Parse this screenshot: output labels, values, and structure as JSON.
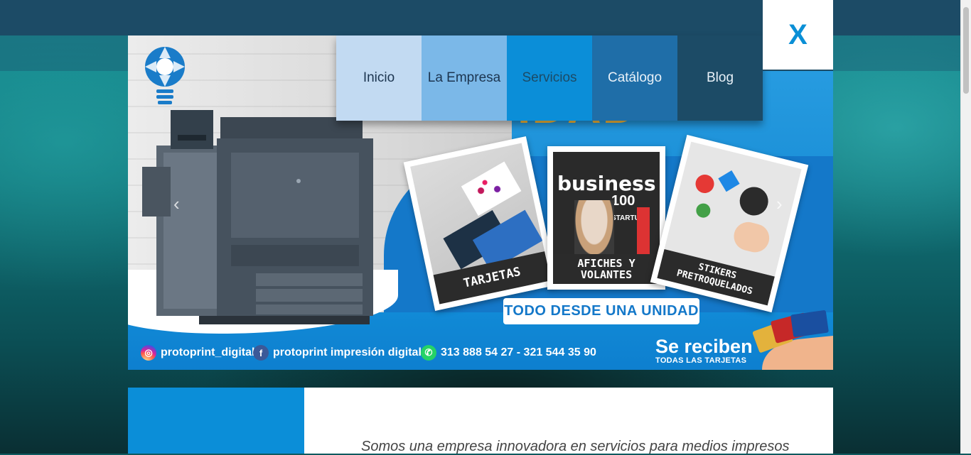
{
  "close_button": {
    "label": "X"
  },
  "nav": {
    "items": [
      {
        "label": "Inicio",
        "bg": "#c2daf2",
        "color": "#1c3550"
      },
      {
        "label": "La Empresa",
        "bg": "#7bb8e8",
        "color": "#1c3550"
      },
      {
        "label": "Servicios",
        "bg": "#0b8ed8",
        "color": "#1c4b66"
      },
      {
        "label": "Catálogo",
        "bg": "#1f6ea8",
        "color": "#e8f1f8"
      },
      {
        "label": "Blog",
        "bg": "#1c4b66",
        "color": "#e8f1f8"
      }
    ]
  },
  "banner": {
    "headline": "IDAD",
    "cards": [
      {
        "caption": "TARJETAS"
      },
      {
        "caption": "AFICHES Y VOLANTES",
        "magazine_title": "business",
        "magazine_number": "100",
        "magazine_sub": "STARTUP"
      },
      {
        "caption": "STIKERS PRETROQUELADOS"
      }
    ],
    "unidad": "TODO DESDE UNA UNIDAD",
    "instagram": "protoprint_digital",
    "facebook": "protoprint impresión digital",
    "whatsapp": "313 888 54 27 - 321 544 35 90",
    "reciben_big": "Se reciben",
    "reciben_small": "TODAS LAS TARJETAS",
    "prev_arrow": "‹",
    "next_arrow": "›"
  },
  "intro": {
    "tagline": "Somos una empresa innovadora en servicios para medios impresos"
  },
  "colors": {
    "topbar": "#1c4b66",
    "accent_blue": "#0b8ed8",
    "headline_yellow": "#f6b83a"
  }
}
